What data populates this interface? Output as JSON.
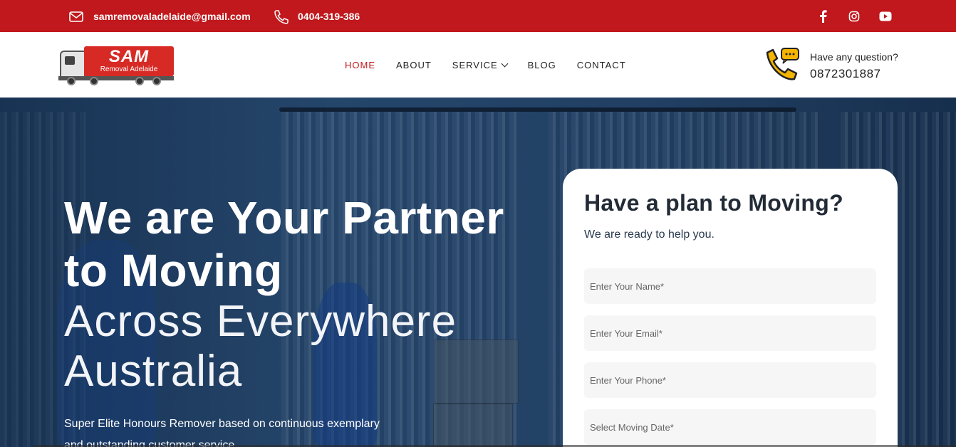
{
  "topbar": {
    "email": "samremovaladelaide@gmail.com",
    "phone": "0404-319-386",
    "social": [
      "facebook-icon",
      "instagram-icon",
      "youtube-icon"
    ]
  },
  "header": {
    "logo": {
      "title": "SAM",
      "subtitle": "Removal Adelaide"
    },
    "nav": [
      {
        "label": "HOME",
        "active": true
      },
      {
        "label": "ABOUT"
      },
      {
        "label": "SERVICE",
        "dropdown": true
      },
      {
        "label": "BLOG"
      },
      {
        "label": "CONTACT"
      }
    ],
    "question_label": "Have any question?",
    "question_phone": "0872301887"
  },
  "hero": {
    "title_line1": "We are Your Partner",
    "title_line2": "to Moving",
    "subtitle_line1": "Across Everywhere",
    "subtitle_line2": "Australia",
    "desc_line1": "Super Elite Honours Remover based on continuous exemplary",
    "desc_line2": "and outstanding customer service"
  },
  "form": {
    "title": "Have a plan to Moving?",
    "subtitle": "We are ready to help you.",
    "name_placeholder": "Enter Your Name*",
    "email_placeholder": "Enter Your Email*",
    "phone_placeholder": "Enter Your Phone*",
    "date_placeholder": "Select Moving Date*"
  },
  "colors": {
    "brand_red": "#c0181c",
    "hero_blue": "#1d3a5c",
    "text_dark": "#222b36"
  }
}
